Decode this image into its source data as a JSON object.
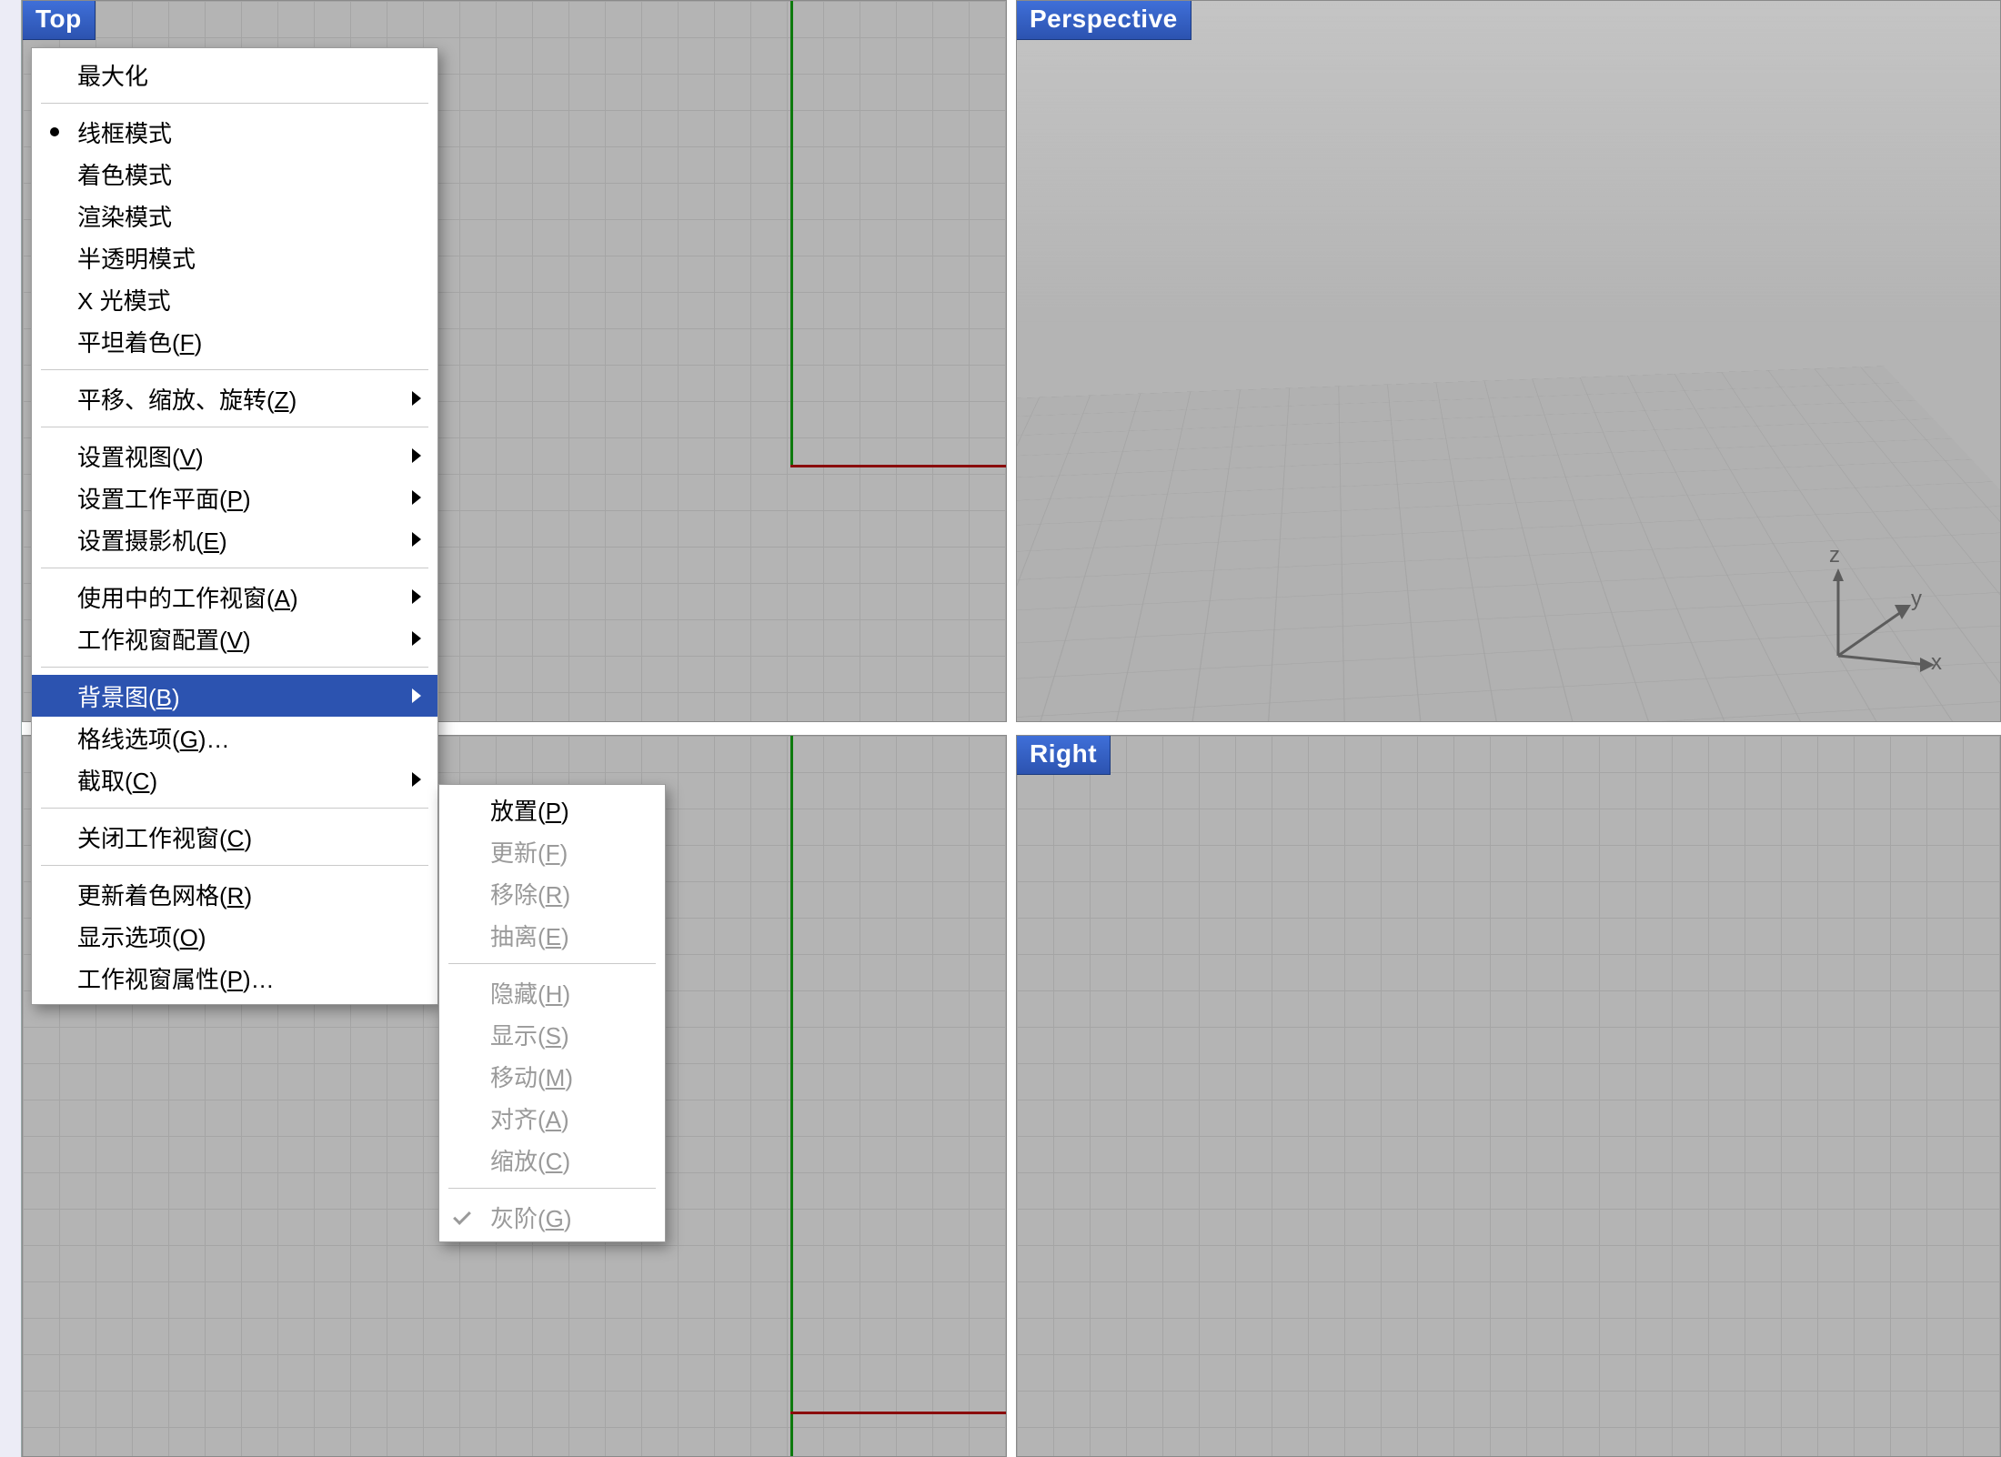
{
  "viewports": {
    "top_label": "Top",
    "perspective_label": "Perspective",
    "right_label": "Right",
    "gizmo": {
      "x": "x",
      "y": "y",
      "z": "z"
    }
  },
  "context_menu": {
    "maximize": "最大化",
    "wireframe": "线框模式",
    "shaded": "着色模式",
    "rendered": "渲染模式",
    "ghosted": "半透明模式",
    "xray_pre": "X ",
    "xray_post": "光模式",
    "flat_pre": "平坦着色(",
    "flat_key": "F",
    "pzr_pre": "平移、缩放、旋转(",
    "pzr_key": "Z",
    "setview_pre": "设置视图(",
    "setview_key": "V",
    "setcplane_pre": "设置工作平面(",
    "setcplane_key": "P",
    "setcamera_pre": "设置摄影机(",
    "setcamera_key": "E",
    "active_vp_pre": "使用中的工作视窗(",
    "active_vp_key": "A",
    "vp_layout_pre": "工作视窗配置(",
    "vp_layout_key": "V",
    "bg_pre": "背景图(",
    "bg_key": "B",
    "grid_pre": "格线选项(",
    "grid_key": "G",
    "grid_post": ")…",
    "capture_pre": "截取(",
    "capture_key": "C",
    "close_vp_pre": "关闭工作视窗(",
    "close_vp_key": "C",
    "refresh_mesh_pre": "更新着色网格(",
    "refresh_mesh_key": "R",
    "show_sel_pre": "显示选项(",
    "show_sel_key": "O",
    "vp_props_pre": "工作视窗属性(",
    "vp_props_key": "P",
    "vp_props_post": ")…",
    "paren_close": ")"
  },
  "submenu": {
    "place_pre": "放置(",
    "place_key": "P",
    "update_pre": "更新(",
    "update_key": "F",
    "remove_pre": "移除(",
    "remove_key": "R",
    "detach_pre": "抽离(",
    "detach_key": "E",
    "hide_pre": "隐藏(",
    "hide_key": "H",
    "show_pre": "显示(",
    "show_key": "S",
    "move_pre": "移动(",
    "move_key": "M",
    "align_pre": "对齐(",
    "align_key": "A",
    "scale_pre": "缩放(",
    "scale_key": "C",
    "gray_pre": "灰阶(",
    "gray_key": "G",
    "paren_close": ")"
  }
}
